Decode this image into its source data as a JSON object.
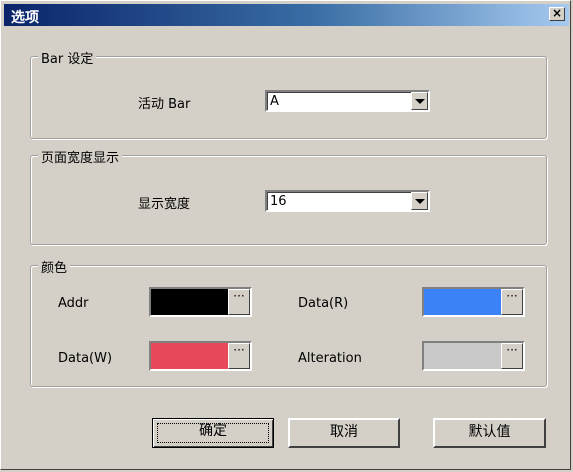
{
  "window": {
    "title": "选项",
    "close_label": "×"
  },
  "bar_settings": {
    "legend": "Bar 设定",
    "active_bar_label": "活动 Bar",
    "active_bar_value": "A"
  },
  "page_width": {
    "legend": "页面宽度显示",
    "display_width_label": "显示宽度",
    "display_width_value": "16"
  },
  "colors": {
    "legend": "颜色",
    "addr_label": "Addr",
    "addr_color": "#000000",
    "data_r_label": "Data(R)",
    "data_r_color": "#3b82f6",
    "data_w_label": "Data(W)",
    "data_w_color": "#e8495a",
    "alteration_label": "Alteration",
    "alteration_color": "#c8c8c8",
    "ellipsis": "···"
  },
  "buttons": {
    "ok": "确定",
    "cancel": "取消",
    "default": "默认值"
  }
}
